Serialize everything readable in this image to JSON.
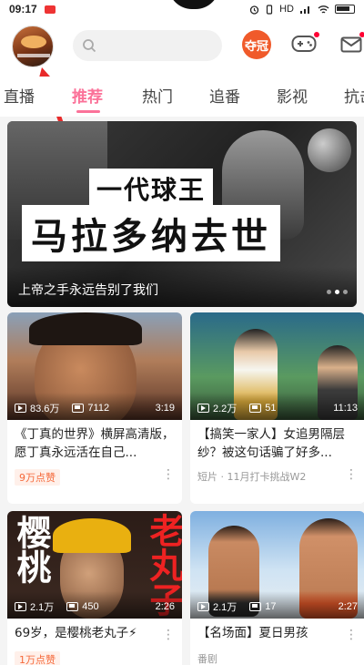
{
  "status_bar": {
    "time": "09:17",
    "network": "HD",
    "signal_text": "4G"
  },
  "header": {
    "search_placeholder": "",
    "gift_label": "夺冠",
    "game_icon": "gamepad-icon",
    "mail_icon": "mail-icon"
  },
  "tabs": [
    "直播",
    "推荐",
    "热门",
    "追番",
    "影视",
    "抗击"
  ],
  "active_tab": "推荐",
  "banner": {
    "subheadline": "一代球王",
    "headline": "马拉多纳去世",
    "caption": "上帝之手永远告别了我们"
  },
  "cards": [
    {
      "views": "83.6万",
      "danmaku": "7112",
      "duration": "3:19",
      "title": "《丁真的世界》横屏高清版，愿丁真永远活在自己...",
      "badge": "9万点赞",
      "meta": ""
    },
    {
      "views": "2.2万",
      "danmaku": "51",
      "duration": "11:13",
      "title": "【搞笑一家人】女追男隔层纱？被这句话骗了好多...",
      "badge": "",
      "meta": "短片 · 11月打卡挑战W2"
    },
    {
      "views": "2.1万",
      "danmaku": "450",
      "duration": "2:26",
      "title": "69岁，是樱桃老丸子⚡",
      "badge": "1万点赞",
      "meta": "",
      "thumb_text_left": "樱桃",
      "thumb_text_right": "老丸子"
    },
    {
      "views": "2.1万",
      "danmaku": "17",
      "duration": "2:27",
      "title": "【名场面】夏日男孩",
      "badge": "",
      "meta": "番剧"
    }
  ],
  "colors": {
    "accent": "#fb7299",
    "badge_text": "#f5693a",
    "gift": "#f05a2a"
  }
}
